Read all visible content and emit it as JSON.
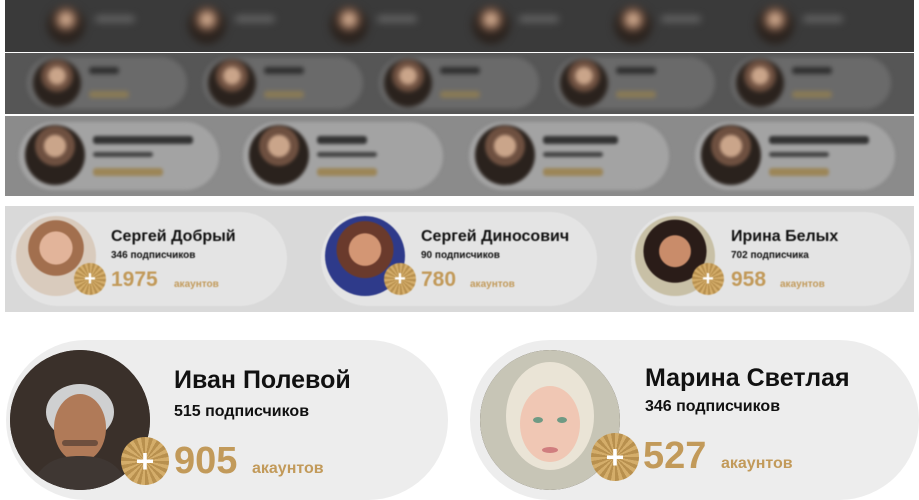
{
  "rows": {
    "row4": [
      {
        "name": "Сергей Добрый",
        "subscribers": "346 подписчиков",
        "count": "1975",
        "unit": "акаунтов"
      },
      {
        "name": "Сергей Диносович",
        "subscribers": "90 подписчиков",
        "count": "780",
        "unit": "акаунтов"
      },
      {
        "name": "Ирина Белых",
        "subscribers": "702 подписчика",
        "count": "958",
        "unit": "акаунтов"
      }
    ],
    "row5": [
      {
        "name": "Иван Полевой",
        "subscribers": "515 подписчиков",
        "count": "905",
        "unit": "акаунтов"
      },
      {
        "name": "Марина Светлая",
        "subscribers": "346 подписчиков",
        "count": "527",
        "unit": "акаунтов"
      }
    ]
  },
  "badge_symbol": "+",
  "colors": {
    "accent_gold": "#c29a5a",
    "card_bg": "#ededed",
    "text_dark": "#111111"
  }
}
